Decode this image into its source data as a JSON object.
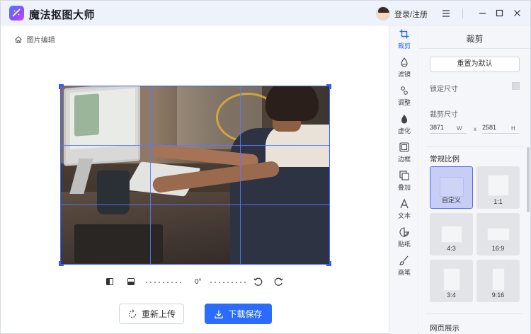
{
  "app": {
    "title": "魔法抠图大师",
    "login_label": "登录/注册"
  },
  "breadcrumb": {
    "label": "图片编辑"
  },
  "editor": {
    "rotation": "0°"
  },
  "actions": {
    "reupload_label": "重新上传",
    "save_label": "下载保存"
  },
  "rail": {
    "items": [
      {
        "label": "裁剪",
        "icon": "crop-icon",
        "active": true
      },
      {
        "label": "滤镜",
        "icon": "filter-icon"
      },
      {
        "label": "调整",
        "icon": "adjust-icon"
      },
      {
        "label": "虚化",
        "icon": "blur-icon"
      },
      {
        "label": "边框",
        "icon": "border-icon"
      },
      {
        "label": "叠加",
        "icon": "overlay-icon"
      },
      {
        "label": "文本",
        "icon": "text-icon"
      },
      {
        "label": "贴纸",
        "icon": "sticker-icon"
      },
      {
        "label": "画笔",
        "icon": "brush-icon"
      }
    ]
  },
  "panel": {
    "title": "裁剪",
    "reset_label": "重置为默认",
    "lock_label": "锁定尺寸",
    "size_label": "裁剪尺寸",
    "width": "3871",
    "width_unit": "W",
    "times": "x",
    "height": "2581",
    "height_unit": "H",
    "ratio_title": "常规比例",
    "ratios": [
      "自定义",
      "1:1",
      "4:3",
      "16:9",
      "3:4",
      "9:16"
    ],
    "selected_ratio": "自定义",
    "next_section": "网页展示"
  },
  "colors": {
    "accent": "#2a6cff",
    "grid": "#3d63ff",
    "selected_ratio": "#c8cdf5"
  }
}
